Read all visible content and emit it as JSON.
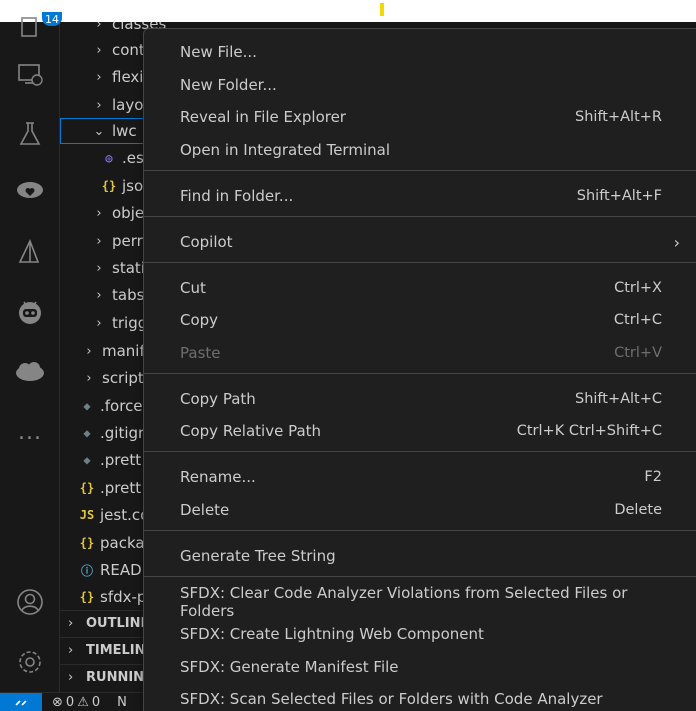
{
  "activity_bar": {
    "badge": "14",
    "icons": [
      "remote-explorer-icon",
      "testing-flask-icon",
      "salesforce-cloud-heart-icon",
      "salesforce-triangle-icon",
      "salesforce-robot-icon",
      "salesforce-cloud-icon",
      "more-icon"
    ],
    "more_label": "...",
    "account_icon": "account-icon",
    "settings_icon": "gear-icon"
  },
  "explorer": {
    "rows": [
      {
        "chev": "›",
        "icon": "",
        "label": "classes"
      },
      {
        "chev": "›",
        "icon": "",
        "label": "cont"
      },
      {
        "chev": "›",
        "icon": "",
        "label": "flexi"
      },
      {
        "chev": "›",
        "icon": "",
        "label": "layo"
      },
      {
        "chev": "⌄",
        "icon": "",
        "label": "lwc"
      },
      {
        "chev": "",
        "icon": "◎",
        "label": ".es"
      },
      {
        "chev": "",
        "icon": "{}",
        "label": "jso"
      },
      {
        "chev": "›",
        "icon": "",
        "label": "obje"
      },
      {
        "chev": "›",
        "icon": "",
        "label": "perr"
      },
      {
        "chev": "›",
        "icon": "",
        "label": "stati"
      },
      {
        "chev": "›",
        "icon": "",
        "label": "tabs"
      },
      {
        "chev": "›",
        "icon": "",
        "label": "trigg"
      },
      {
        "chev": "›",
        "icon": "",
        "label": "manif"
      },
      {
        "chev": "›",
        "icon": "",
        "label": "script"
      },
      {
        "chev": "",
        "icon": "◆",
        "label": ".force"
      },
      {
        "chev": "",
        "icon": "◆",
        "label": ".gitigr"
      },
      {
        "chev": "",
        "icon": "◆",
        "label": ".prett"
      },
      {
        "chev": "",
        "icon": "{}",
        "label": ".prett"
      },
      {
        "chev": "",
        "icon": "JS",
        "label": "jest.co"
      },
      {
        "chev": "",
        "icon": "{}",
        "label": "packa"
      },
      {
        "chev": "",
        "icon": "ⓘ",
        "label": "READ"
      },
      {
        "chev": "",
        "icon": "{}",
        "label": "sfdx-p"
      }
    ],
    "sections": [
      "OUTLINE",
      "TIMELINE",
      "RUNNING"
    ]
  },
  "status_bar": {
    "remote_icon": "remote-icon",
    "errors": "0",
    "warnings": "0",
    "extra": "N"
  },
  "context_menu": {
    "items": [
      {
        "label": "New File...",
        "shortcut": ""
      },
      {
        "label": "New Folder...",
        "shortcut": ""
      },
      {
        "label": "Reveal in File Explorer",
        "shortcut": "Shift+Alt+R"
      },
      {
        "label": "Open in Integrated Terminal",
        "shortcut": ""
      },
      {
        "label": "Find in Folder...",
        "shortcut": "Shift+Alt+F"
      },
      {
        "label": "Copilot",
        "shortcut": ""
      },
      {
        "label": "Cut",
        "shortcut": "Ctrl+X"
      },
      {
        "label": "Copy",
        "shortcut": "Ctrl+C"
      },
      {
        "label": "Paste",
        "shortcut": "Ctrl+V"
      },
      {
        "label": "Copy Path",
        "shortcut": "Shift+Alt+C"
      },
      {
        "label": "Copy Relative Path",
        "shortcut": "Ctrl+K Ctrl+Shift+C"
      },
      {
        "label": "Rename...",
        "shortcut": "F2"
      },
      {
        "label": "Delete",
        "shortcut": "Delete"
      },
      {
        "label": "Generate Tree String",
        "shortcut": ""
      },
      {
        "label": "SFDX: Clear Code Analyzer Violations from Selected Files or Folders",
        "shortcut": ""
      },
      {
        "label": "SFDX: Create Lightning Web Component",
        "shortcut": ""
      },
      {
        "label": "SFDX: Generate Manifest File",
        "shortcut": ""
      },
      {
        "label": "SFDX: Scan Selected Files or Folders with Code Analyzer",
        "shortcut": ""
      }
    ],
    "submenu_arrow": "›"
  },
  "colors": {
    "accent": "#0078d4",
    "background": "#181818",
    "menu_background": "#1f1f1f",
    "json_icon": "#e2c541",
    "eslint_icon": "#8b7cf6",
    "gear_file_icon": "#6d8086"
  }
}
